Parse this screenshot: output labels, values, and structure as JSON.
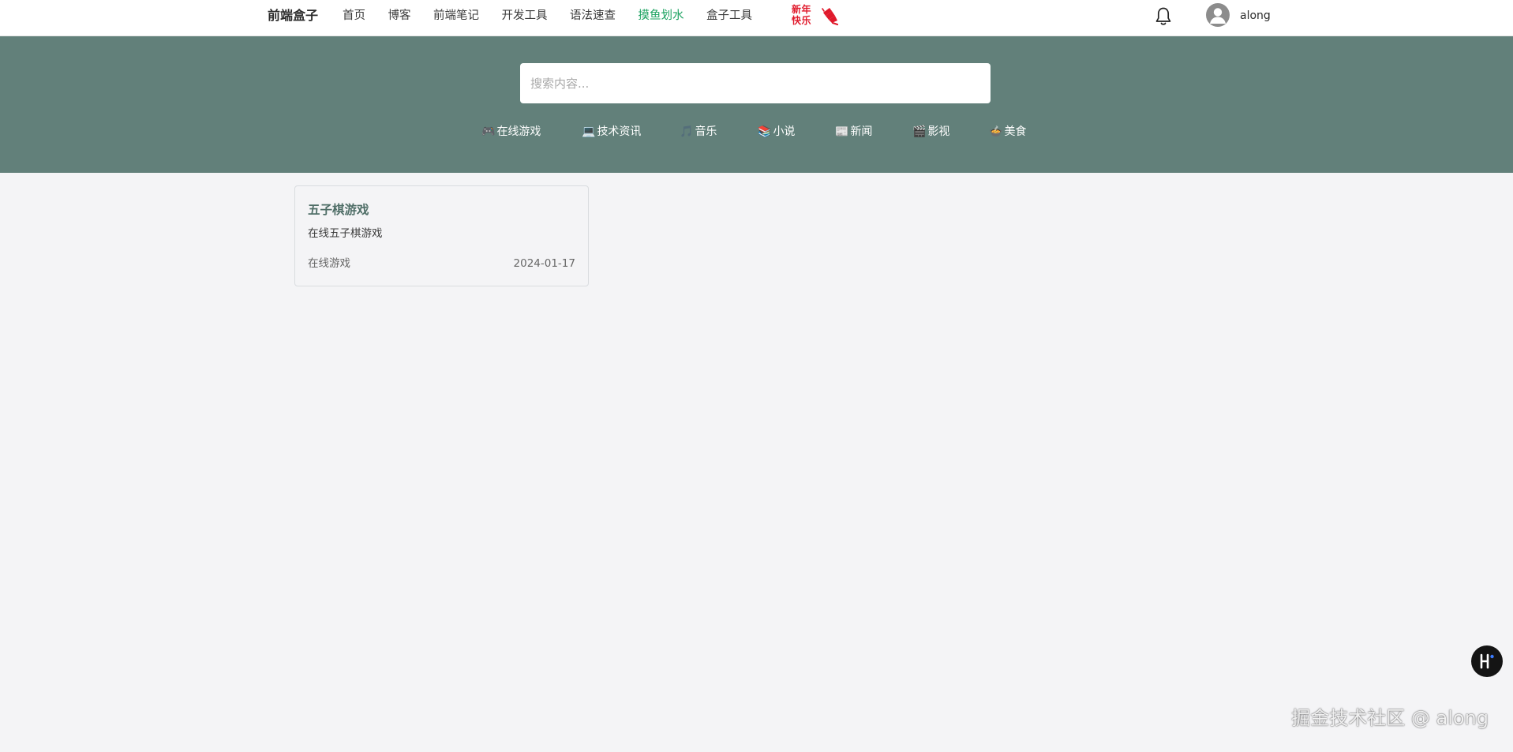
{
  "header": {
    "brand": "前端盒子",
    "nav": [
      {
        "label": "首页",
        "active": false
      },
      {
        "label": "博客",
        "active": false
      },
      {
        "label": "前端笔记",
        "active": false
      },
      {
        "label": "开发工具",
        "active": false
      },
      {
        "label": "语法速查",
        "active": false
      },
      {
        "label": "摸鱼划水",
        "active": true
      },
      {
        "label": "盒子工具",
        "active": false
      }
    ],
    "new_year_line1": "新年",
    "new_year_line2": "快乐",
    "username": "along"
  },
  "search": {
    "placeholder": "搜索内容..."
  },
  "categories": [
    {
      "emoji": "🎮",
      "label": "在线游戏"
    },
    {
      "emoji": "💻",
      "label": "技术资讯"
    },
    {
      "emoji": "🎵",
      "label": "音乐"
    },
    {
      "emoji": "📚",
      "label": "小说"
    },
    {
      "emoji": "📰",
      "label": "新闻"
    },
    {
      "emoji": "🎬",
      "label": "影视"
    },
    {
      "emoji": "🍲",
      "label": "美食"
    }
  ],
  "cards": [
    {
      "title": "五子棋游戏",
      "description": "在线五子棋游戏",
      "tag": "在线游戏",
      "date": "2024-01-17"
    }
  ],
  "watermark": "掘金技术社区 @ along",
  "colors": {
    "accent": "#19a15f",
    "hero_bg": "#62807a",
    "card_title": "#4f6e67",
    "new_year_red": "#e0192b"
  }
}
